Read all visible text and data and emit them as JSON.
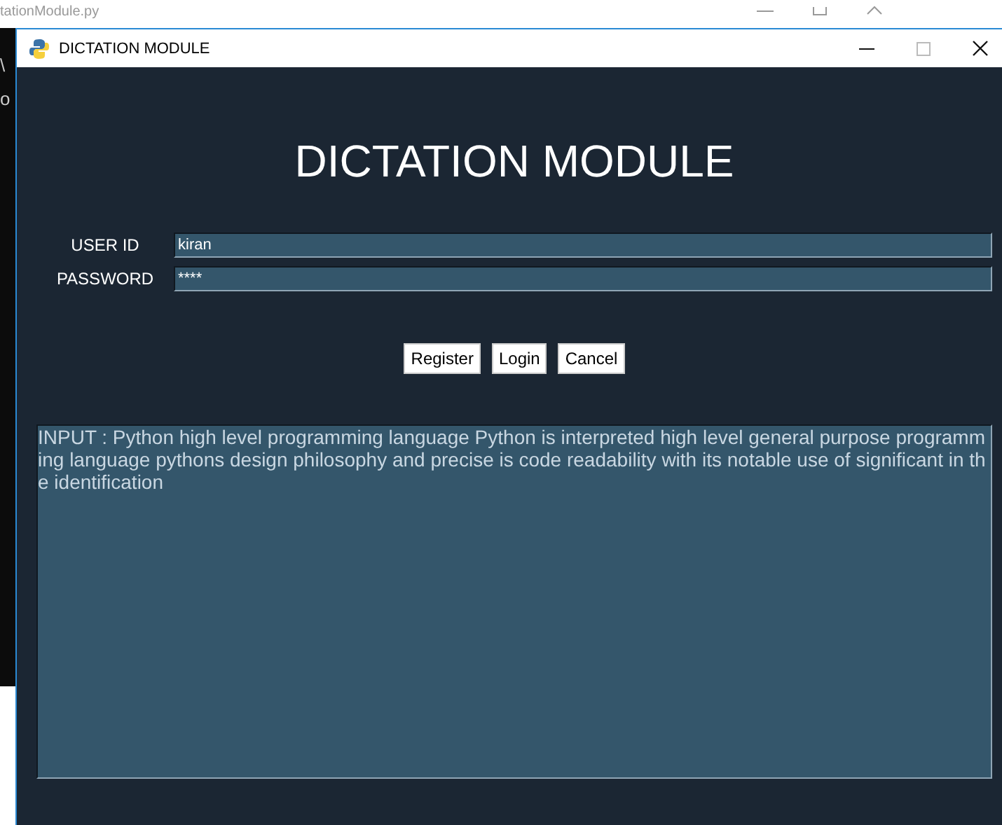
{
  "back_window": {
    "title": "tationModule.py",
    "side_text": [
      "\\",
      "o"
    ]
  },
  "window": {
    "title": "DICTATION MODULE"
  },
  "heading": "DICTATION MODULE",
  "fields": [
    {
      "label": "USER ID",
      "value": "kiran"
    },
    {
      "label": "PASSWORD",
      "value": "****"
    }
  ],
  "buttons": [
    "Register",
    "Login",
    "Cancel"
  ],
  "output": {
    "text": "INPUT : Python high level programming language Python is interpreted high level general purpose programming language pythons design philosophy and precise is code readability with its notable use of significant in the identification"
  }
}
